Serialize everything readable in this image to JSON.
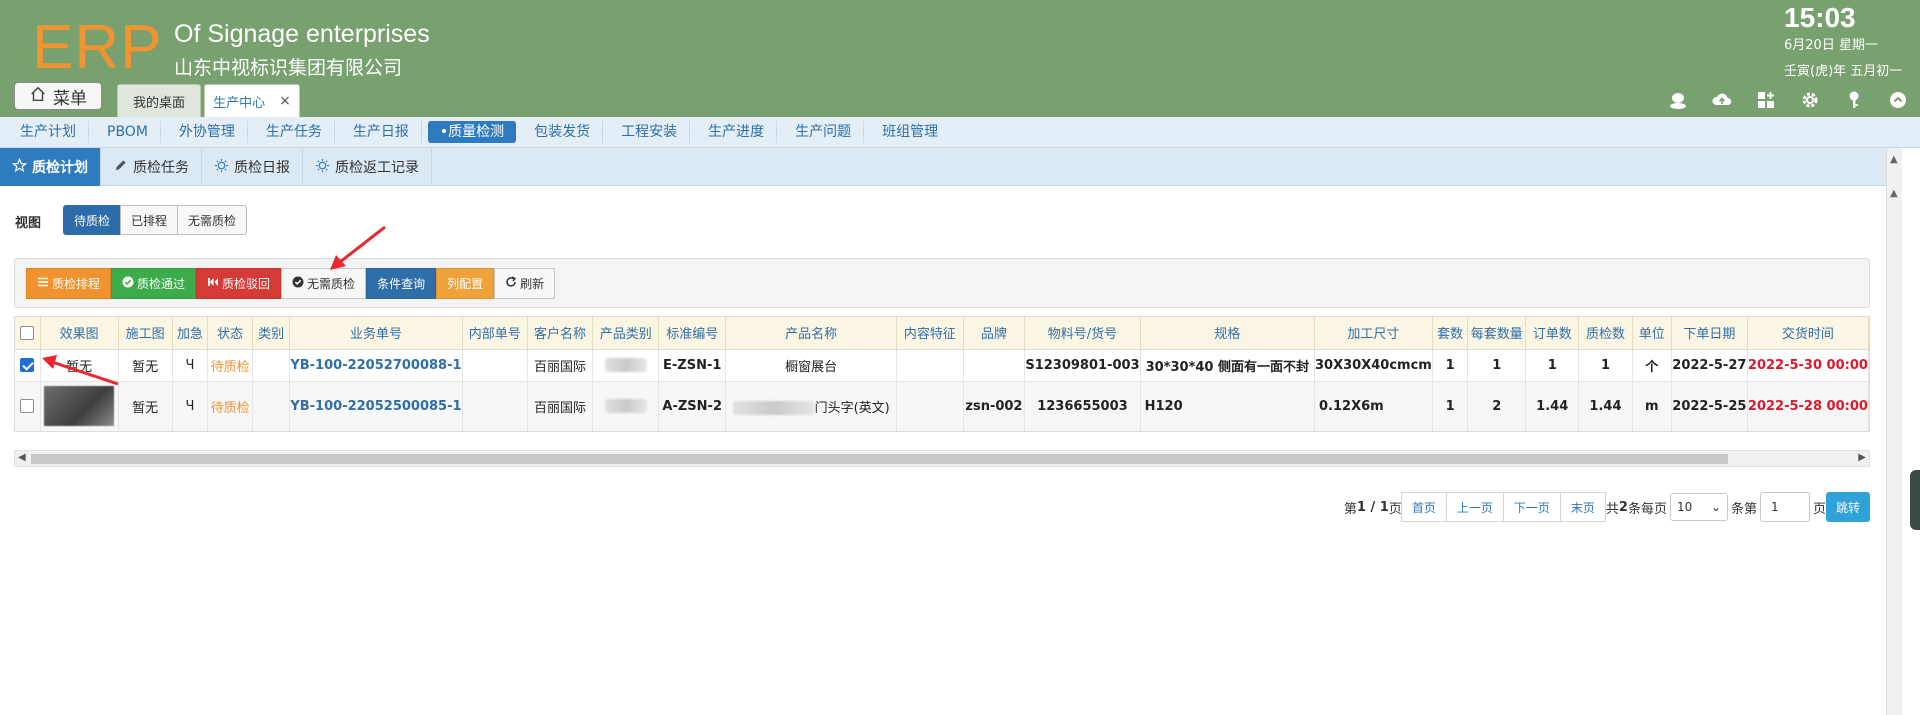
{
  "header": {
    "logo": "ERP",
    "company_en": "Of Signage enterprises",
    "company_cn": "山东中视标识集团有限公司",
    "clock": "15:03",
    "date_line1": "6月20日 星期一",
    "date_line2": "壬寅(虎)年 五月初一",
    "menu_label": "菜单",
    "tabs": [
      {
        "label": "我的桌面"
      },
      {
        "label": "生产中心",
        "close": "×"
      }
    ]
  },
  "nav": {
    "items": [
      "生产计划",
      "PBOM",
      "外协管理",
      "生产任务",
      "生产日报",
      "•质量检测",
      "包装发货",
      "工程安装",
      "生产进度",
      "生产问题",
      "班组管理"
    ]
  },
  "subtabs": [
    "质检计划",
    "质检任务",
    "质检日报",
    "质检返工记录"
  ],
  "view": {
    "label": "视图",
    "options": [
      "待质检",
      "已排程",
      "无需质检"
    ]
  },
  "toolbar": {
    "buttons": [
      "质检排程",
      "质检通过",
      "质检驳回",
      "无需质检",
      "条件查询",
      "列配置",
      "刷新"
    ]
  },
  "table": {
    "headers": [
      "效果图",
      "施工图",
      "加急",
      "状态",
      "类别",
      "业务单号",
      "内部单号",
      "客户名称",
      "产品类别",
      "标准编号",
      "产品名称",
      "内容特征",
      "品牌",
      "物料号/货号",
      "规格",
      "加工尺寸",
      "套数",
      "每套数量",
      "订单数",
      "质检数",
      "单位",
      "下单日期",
      "交货时间"
    ],
    "rows": [
      {
        "checked": true,
        "effect": "暂无",
        "construct": "暂无",
        "urgent": "Ч",
        "status": "待质检",
        "category": "",
        "order_no": "YB-100-22052700088-1",
        "internal_no": "",
        "customer": "百丽国际",
        "std_no": "E-ZSN-1",
        "product_name": "橱窗展台",
        "content": "",
        "brand": "",
        "material_no": "S12309801-003",
        "spec": "30*30*40 侧面有一面不封",
        "size": "30X30X40cmcm",
        "sets": "1",
        "qty_per_set": "1",
        "order_qty": "1",
        "qc_qty": "1",
        "unit": "个",
        "order_date": "2022-5-27",
        "delivery": "2022-5-30 00:00"
      },
      {
        "checked": false,
        "effect": "",
        "construct": "暂无",
        "urgent": "Ч",
        "status": "待质检",
        "category": "",
        "order_no": "YB-100-22052500085-1",
        "internal_no": "",
        "customer": "百丽国际",
        "std_no": "A-ZSN-2",
        "product_name_suffix": "门头字(英文)",
        "content": "",
        "brand": "zsn-002",
        "material_no": "1236655003",
        "spec": "H120",
        "size": "0.12X6m",
        "sets": "1",
        "qty_per_set": "2",
        "order_qty": "1.44",
        "qc_qty": "1.44",
        "unit": "m",
        "order_date": "2022-5-25",
        "delivery": "2022-5-28 00:00"
      }
    ]
  },
  "pager": {
    "prefix": "第",
    "current": "1 / 1",
    "suffix": "页",
    "first": "首页",
    "prev": "上一页",
    "next": "下一页",
    "last": "末页",
    "total_prefix": "共",
    "total": "2",
    "per_page_label": "条每页",
    "per_page": "10",
    "goto_prefix": "条第",
    "goto_value": "1",
    "goto_suffix": "页",
    "go": "跳转"
  },
  "colors": {
    "header_bg": "#78a16f",
    "logo": "#f0942f",
    "accent_blue": "#2f7bbf",
    "status_orange": "#f0932e",
    "delivery_red": "#e0182b"
  }
}
